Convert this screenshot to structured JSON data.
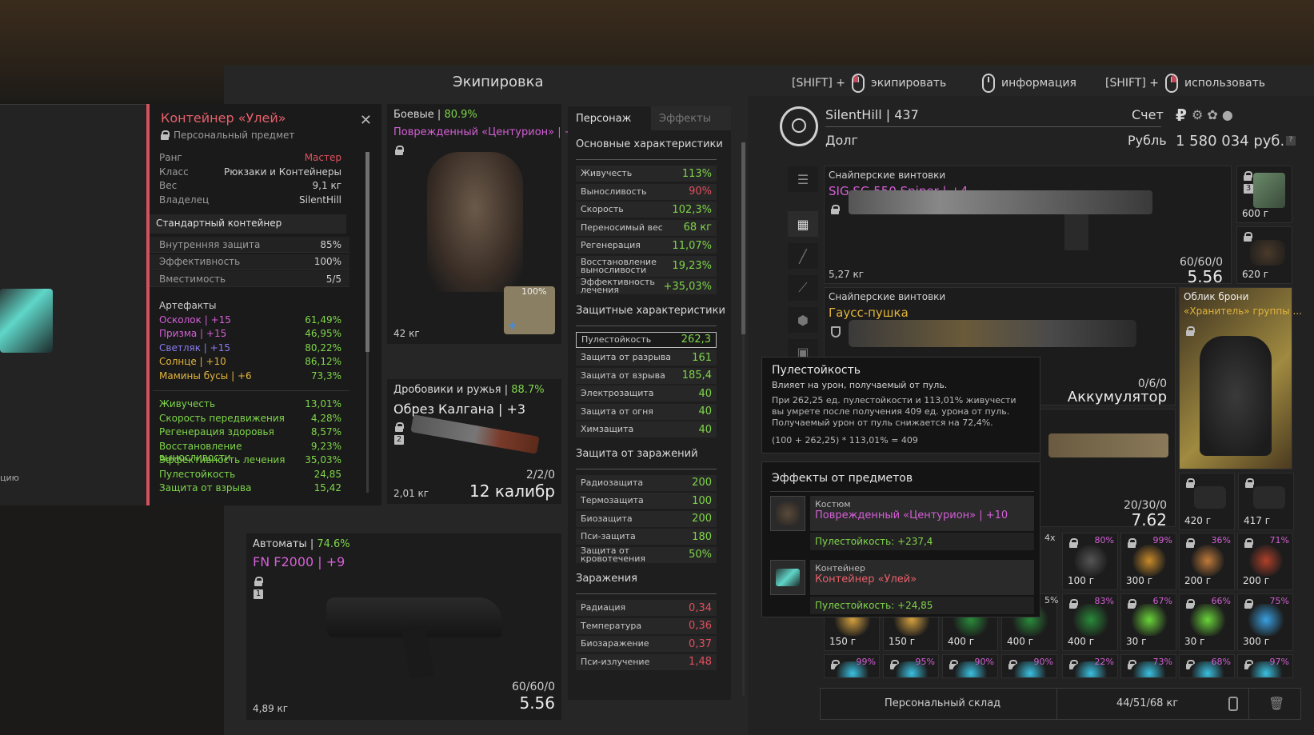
{
  "header": {
    "title": "Экипировка",
    "hints": [
      {
        "prefix": "[SHIFT] +",
        "action": "экипировать"
      },
      {
        "prefix": "",
        "action": "информация"
      },
      {
        "prefix": "[SHIFT] +",
        "action": "использовать"
      }
    ]
  },
  "left_cut_text": "цию",
  "info_panel": {
    "title": "Контейнер «Улей»",
    "subtitle": "Персональный предмет",
    "props": [
      {
        "k": "Ранг",
        "v": "Мастер",
        "color": "#e0505e"
      },
      {
        "k": "Класс",
        "v": "Рюкзаки и Контейнеры"
      },
      {
        "k": "Вес",
        "v": "9,1 кг"
      },
      {
        "k": "Владелец",
        "v": "SilentHill"
      }
    ],
    "section": "Стандартный контейнер",
    "container_stats": [
      {
        "k": "Внутренняя защита",
        "v": "85%"
      },
      {
        "k": "Эффективность",
        "v": "100%"
      },
      {
        "k": "Вместимость",
        "v": "5/5"
      }
    ],
    "artifacts_label": "Артефакты",
    "artifacts": [
      {
        "k": "Осколок | +15",
        "v": "61,49%",
        "color": "#d45fd6"
      },
      {
        "k": "Призма | +15",
        "v": "46,95%",
        "color": "#d45fd6"
      },
      {
        "k": "Светляк | +15",
        "v": "80,22%",
        "color": "#8a7cf0"
      },
      {
        "k": "Солнце | +10",
        "v": "86,12%",
        "color": "#e2b43c"
      },
      {
        "k": "Мамины бусы | +6",
        "v": "73,3%",
        "color": "#e2b43c"
      }
    ],
    "bonuses": [
      {
        "k": "Живучесть",
        "v": "13,01%"
      },
      {
        "k": "Скорость передвижения",
        "v": "4,28%"
      },
      {
        "k": "Регенерация здоровья",
        "v": "8,57%"
      },
      {
        "k": "Восстановление выносливости",
        "v": "9,23%"
      },
      {
        "k": "Эффективность лечения",
        "v": "35,03%"
      },
      {
        "k": "Пулестойкость",
        "v": "24,85"
      },
      {
        "k": "Защита от взрыва",
        "v": "15,42"
      }
    ]
  },
  "armor_card": {
    "category": "Боевые",
    "pct": "80.9%",
    "name": "Поврежденный «Центурион» | +1...",
    "weight": "42 кг",
    "durability": "100%"
  },
  "shotgun_card": {
    "category": "Дробовики и ружья",
    "pct": "88.7%",
    "name": "Обрез Калгана | +3",
    "weight": "2,01 кг",
    "ammo": "2/2/0",
    "caliber": "12 калибр",
    "slot_number": "2"
  },
  "rifle_card": {
    "category": "Автоматы",
    "pct": "74.6%",
    "name": "FN F2000 | +9",
    "weight": "4,89 кг",
    "ammo": "60/60/0",
    "caliber": "5.56",
    "slot_number": "1"
  },
  "stats": {
    "tabs": [
      "Персонаж",
      "Эффекты"
    ],
    "main_title": "Основные характеристики",
    "main": [
      {
        "k": "Живучесть",
        "v": "113%",
        "c": "g"
      },
      {
        "k": "Выносливость",
        "v": "90%",
        "c": "r"
      },
      {
        "k": "Скорость",
        "v": "102,3%",
        "c": "g"
      },
      {
        "k": "Переносимый вес",
        "v": "68 кг",
        "c": "g"
      },
      {
        "k": "Регенерация",
        "v": "11,07%",
        "c": "g"
      },
      {
        "k": "Восстановление выносливости",
        "v": "19,23%",
        "c": "g"
      },
      {
        "k": "Эффективность лечения",
        "v": "+35,03%",
        "c": "g"
      }
    ],
    "def_title": "Защитные характеристики",
    "defense": [
      {
        "k": "Пулестойкость",
        "v": "262,3",
        "c": "g"
      },
      {
        "k": "Защита от разрыва",
        "v": "161",
        "c": "g"
      },
      {
        "k": "Защита от взрыва",
        "v": "185,4",
        "c": "g"
      },
      {
        "k": "Электрозащита",
        "v": "40",
        "c": "g"
      },
      {
        "k": "Защита от огня",
        "v": "40",
        "c": "g"
      },
      {
        "k": "Химзащита",
        "v": "40",
        "c": "g"
      }
    ],
    "inf_title": "Защита от заражений",
    "infection": [
      {
        "k": "Радиозащита",
        "v": "200",
        "c": "g"
      },
      {
        "k": "Термозащита",
        "v": "100",
        "c": "g"
      },
      {
        "k": "Биозащита",
        "v": "200",
        "c": "g"
      },
      {
        "k": "Пси-защита",
        "v": "180",
        "c": "g"
      },
      {
        "k": "Защита от кровотечения",
        "v": "50%",
        "c": "g"
      }
    ],
    "cont_title": "Заражения",
    "contamination": [
      {
        "k": "Радиация",
        "v": "0,34",
        "c": "r"
      },
      {
        "k": "Температура",
        "v": "0,36",
        "c": "r"
      },
      {
        "k": "Биозаражение",
        "v": "0,37",
        "c": "r"
      },
      {
        "k": "Пси-излучение",
        "v": "1,48",
        "c": "r"
      }
    ]
  },
  "profile": {
    "name": "SilentHill | 437",
    "debt": "Долг",
    "account": "Счет",
    "currency": "Рубль",
    "balance": "1 580 034 руб.",
    "currency_symbol": "₽",
    "help": "?"
  },
  "inventory": {
    "weapon1": {
      "category": "Снайперские винтовки",
      "name": "SIG SG 550 Sniper | +4",
      "weight": "5,27 кг",
      "ammo": "60/60/0",
      "caliber": "5.56"
    },
    "weapon2": {
      "category": "Снайперские винтовки",
      "name": "Гаусс-пушка",
      "ammo": "0/6/0",
      "caliber": "Аккумулятор"
    },
    "weapon3": {
      "ammo": "20/30/0",
      "caliber": "7.62"
    },
    "armor_skin": {
      "category": "Облик брони",
      "name": "«Хранитель» группы ..."
    },
    "side_items": [
      {
        "w": "600 г",
        "badge": "3"
      },
      {
        "w": "620 г"
      }
    ],
    "small_slots_row1": [
      {
        "w": "420 г"
      },
      {
        "w": "417 г"
      }
    ],
    "grid_row1": [
      {
        "w": "100 г",
        "pct": "80%"
      },
      {
        "w": "300 г",
        "pct": "99%"
      },
      {
        "w": "200 г",
        "pct": "36%"
      },
      {
        "w": "200 г",
        "pct": "71%"
      }
    ],
    "grid_row1_partial": "4x",
    "grid_row2_partial": "5%",
    "grid_row2": [
      {
        "w": "150 г"
      },
      {
        "w": "150 г"
      },
      {
        "w": "400 г"
      },
      {
        "w": "400 г"
      },
      {
        "w": "400 г",
        "pct": "83%"
      },
      {
        "w": "30 г",
        "pct": "67%"
      },
      {
        "w": "30 г",
        "pct": "66%"
      },
      {
        "w": "300 г",
        "pct": "75%"
      }
    ],
    "grid_row3": [
      {
        "pct": "99%"
      },
      {
        "pct": "95%"
      },
      {
        "pct": "90%"
      },
      {
        "pct": "90%"
      },
      {
        "pct": "22%"
      },
      {
        "pct": "73%"
      },
      {
        "pct": "68%"
      },
      {
        "pct": "97%"
      }
    ],
    "storage_label": "Персональный склад",
    "storage_weight": "44/51/68 кг"
  },
  "tooltip": {
    "title": "Пулестойкость",
    "subtitle": "Влияет на урон, получаемый от пуль.",
    "body": "При 262,25 ед. пулестойкости и 113,01% живучести вы умрете после получения 409 ед. урона от пуль. Получаемый урон от пуль снижается на 72,4%.",
    "formula": "(100 + 262,25) * 113,01% = 409"
  },
  "effects": {
    "title": "Эффекты от предметов",
    "items": [
      {
        "type": "Костюм",
        "name": "Поврежденный «Центурион» | +10",
        "bonus": "Пулестойкость: +237,4"
      },
      {
        "type": "Контейнер",
        "name": "Контейнер «Улей»",
        "bonus": "Пулестойкость: +24,85"
      }
    ]
  }
}
